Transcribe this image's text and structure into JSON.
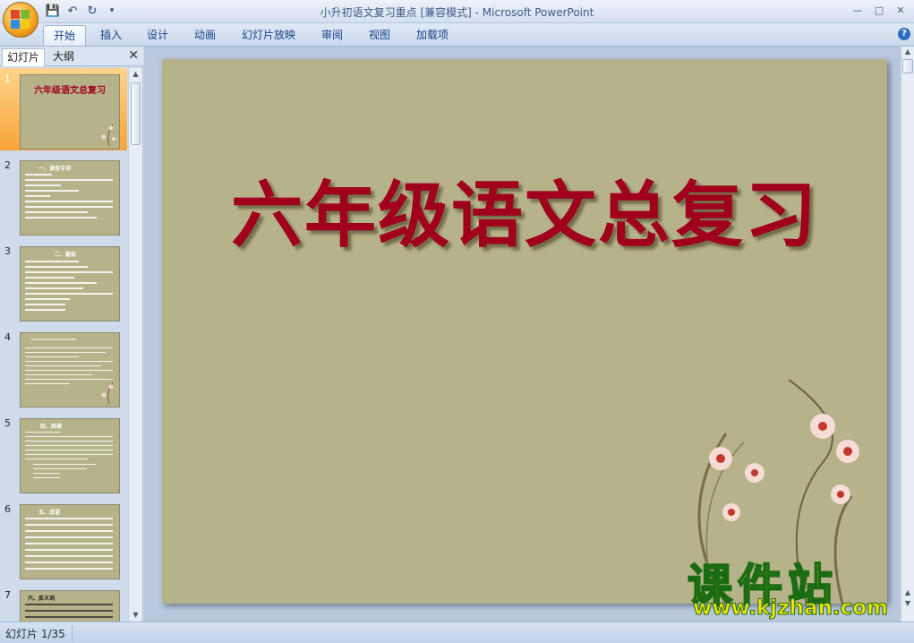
{
  "window": {
    "title": "小升初语文复习重点 [兼容模式] - Microsoft PowerPoint"
  },
  "quick_access": [
    {
      "name": "save-icon"
    },
    {
      "name": "undo-icon"
    },
    {
      "name": "redo-icon"
    },
    {
      "name": "customize-icon"
    }
  ],
  "ribbon": {
    "tabs": [
      "开始",
      "插入",
      "设计",
      "动画",
      "幻灯片放映",
      "审阅",
      "视图",
      "加载项"
    ],
    "active_tab": "开始"
  },
  "left_pane": {
    "tabs": [
      "幻灯片",
      "大纲"
    ],
    "active_tab": "幻灯片",
    "slides": [
      {
        "number": "1",
        "title": "六年级语文总复习",
        "selected": true
      },
      {
        "number": "2",
        "heading": "一、读音字词",
        "selected": false
      },
      {
        "number": "3",
        "heading": "二、题目",
        "selected": false
      },
      {
        "number": "4",
        "heading": "",
        "selected": false
      },
      {
        "number": "5",
        "heading": "四、阅读",
        "selected": false
      },
      {
        "number": "6",
        "heading": "五、成语",
        "selected": false
      },
      {
        "number": "7",
        "heading": "六、反义词",
        "selected": false
      }
    ]
  },
  "slide": {
    "title": "六年级语文总复习",
    "title_color": "#a0001c",
    "background_color": "#b6b38a"
  },
  "watermark": {
    "text": "课件站",
    "url": "www.kjzhan.com"
  },
  "status_bar": {
    "slide_counter": "幻灯片 1/35"
  }
}
